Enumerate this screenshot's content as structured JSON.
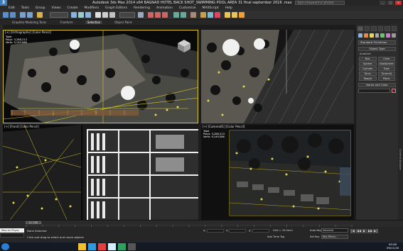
{
  "window": {
    "app_icon": "3ds-max-icon",
    "title": "Autodesk 3ds Max 2014 x64   BAGNAD HOTEL BACK SHOT_SWIMMING POOL AREA 31 final  september 2016 .max",
    "search_placeholder": "Type a keyword or phrase",
    "controls": [
      "_",
      "□",
      "×"
    ]
  },
  "menus": [
    "Edit",
    "Tools",
    "Group",
    "Views",
    "Create",
    "Modifiers",
    "Graph Editors",
    "Rendering",
    "Animation",
    "Customize",
    "MAXScript",
    "Help"
  ],
  "ribbon": {
    "tabs": [
      "Graphite Modeling Tools",
      "Freeform",
      "Selection",
      "Object Paint"
    ],
    "active_index": 2
  },
  "viewports": {
    "top": {
      "label": "[+] [Orthographic] [Color Pencil]",
      "stats": [
        "Total",
        "Polys:  3,286,213",
        "Verts:  9,149,086"
      ]
    },
    "persp": {
      "label": ""
    },
    "front": {
      "label": "[+] [Front] [Color Pencil]"
    },
    "camera": {
      "label": "[+] [Camera01] [Color Pencil]",
      "stats": [
        "Total",
        "Polys:  3,286,213",
        "Verts:  9,149,086"
      ]
    }
  },
  "command_panel": {
    "category": "Standard Primitives",
    "object_type_header": "Object Type",
    "autogrid": "AutoGrid",
    "primitives": [
      "Box",
      "Cone",
      "Sphere",
      "GeoSphere",
      "Cylinder",
      "Tube",
      "Torus",
      "Pyramid",
      "Teapot",
      "Plane"
    ],
    "name_color_header": "Name and Color",
    "swatch_color": "#8a1020"
  },
  "side_label": "Content Browser",
  "timeline": {
    "frame": "0 / 100",
    "ticks": [
      "0",
      "5",
      "10",
      "15",
      "20",
      "25",
      "30",
      "35",
      "40",
      "45",
      "50",
      "55",
      "60",
      "65",
      "70",
      "75",
      "80",
      "85",
      "90",
      "95",
      "100"
    ]
  },
  "status": {
    "maxscript_label": "Max to Physc",
    "selection": "None Selected",
    "prompt": "Click and drag to select and move objects",
    "x_label": "X:",
    "y_label": "Y:",
    "z_label": "Z:",
    "grid": "Grid = 10.0mm",
    "add_time_tag": "Add Time Tag",
    "auto_key": "Auto Key",
    "set_key": "Set Key",
    "key_select": "Selected",
    "key_filters": "Key Filters...",
    "playback": [
      "|◀",
      "◀◀",
      "▶",
      "▶▶",
      "▶|"
    ]
  },
  "taskbar": {
    "clock_time": "05:08",
    "clock_date": "09/11/16"
  },
  "colors": {
    "accent_selection": "#d8c72a",
    "background": "#1d1d1d",
    "taskbar": "#141a24"
  }
}
